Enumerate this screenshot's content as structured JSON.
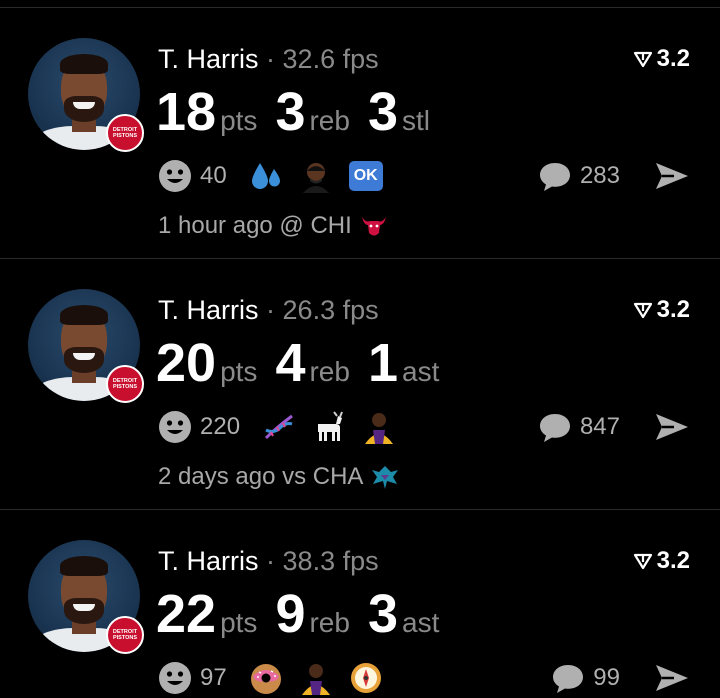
{
  "feed": {
    "cards": [
      {
        "player": "T. Harris",
        "separator": "·",
        "fps": "32.6 fps",
        "rating": "3.2",
        "team_badge": [
          "DETROIT",
          "PISTONS"
        ],
        "stats": [
          {
            "value": "18",
            "label": "pts"
          },
          {
            "value": "3",
            "label": "reb"
          },
          {
            "value": "3",
            "label": "stl"
          }
        ],
        "reaction_count": "40",
        "reaction_emojis": [
          "sweat-droplets-icon",
          "player-emoji-icon",
          "ok-icon"
        ],
        "ok_label": "OK",
        "comment_count": "283",
        "meta": "1 hour ago @ CHI",
        "opponent_logo": "bulls-logo-icon"
      },
      {
        "player": "T. Harris",
        "separator": "·",
        "fps": "26.3 fps",
        "rating": "3.2",
        "team_badge": [
          "DETROIT",
          "PISTONS"
        ],
        "stats": [
          {
            "value": "20",
            "label": "pts"
          },
          {
            "value": "4",
            "label": "reb"
          },
          {
            "value": "1",
            "label": "ast"
          }
        ],
        "reaction_count": "220",
        "reaction_emojis": [
          "dna-icon",
          "goat-icon",
          "lakers-player-icon"
        ],
        "comment_count": "847",
        "meta": "2 days ago vs CHA",
        "opponent_logo": "hornets-logo-icon"
      },
      {
        "player": "T. Harris",
        "separator": "·",
        "fps": "38.3 fps",
        "rating": "3.2",
        "team_badge": [
          "DETROIT",
          "PISTONS"
        ],
        "stats": [
          {
            "value": "22",
            "label": "pts"
          },
          {
            "value": "9",
            "label": "reb"
          },
          {
            "value": "3",
            "label": "ast"
          }
        ],
        "reaction_count": "97",
        "reaction_emojis": [
          "doughnut-icon",
          "lakers-player-icon",
          "compass-icon"
        ],
        "comment_count": "99"
      }
    ]
  },
  "colors": {
    "background": "#000000",
    "primary_text": "#ffffff",
    "secondary_text": "#8a8a8a",
    "divider": "#2a2a2a",
    "pistons_red": "#c8102e",
    "ok_blue": "#3d7bd6"
  }
}
